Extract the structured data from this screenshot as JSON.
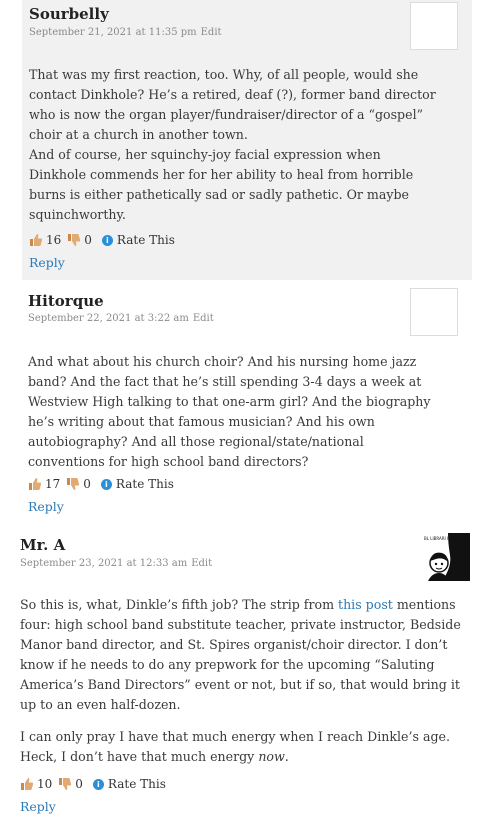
{
  "comments": [
    {
      "author": "Sourbelly",
      "date": "September 21, 2021 at 11:35 pm",
      "edit_label": "Edit",
      "paragraphs": [
        "That was my first reaction, too. Why, of all people, would she contact Dinkhole? He’s a retired, deaf (?), former band director who is now the organ player/fundraiser/director of a “gospel” choir at a church in another town.",
        "And of course, her squinchy-joy facial expression when Dinkhole commends her for her ability to heal from horrible burns is either pathetically sad or sadly pathetic. Or maybe squinchworthy."
      ],
      "likes": "16",
      "dislikes": "0",
      "rate_label": "Rate This",
      "reply_label": "Reply"
    },
    {
      "author": "Hitorque",
      "date": "September 22, 2021 at 3:22 am",
      "edit_label": "Edit",
      "paragraphs": [
        "And what about his church choir? And his nursing home jazz band? And the fact that he’s still spending 3-4 days a week at Westview High talking to that one-arm girl? And the biography he’s writing about that famous musician? And his own autobiography? And all those regional/state/national conventions for high school band directors?"
      ],
      "likes": "17",
      "dislikes": "0",
      "rate_label": "Rate This",
      "reply_label": "Reply"
    },
    {
      "author": "Mr. A",
      "date": "September 23, 2021 at 12:33 am",
      "edit_label": "Edit",
      "p1_before": "So this is, what, Dinkle’s fifth job? The strip from ",
      "p1_link": "this post",
      "p1_after": " mentions four: high school band substitute teacher, private instructor, Bedside Manor band director, and St. Spires organist/choir director. I don’t know if he needs to do any prepwork for the upcoming “Saluting America’s Band Directors” event or not, but if so, that would bring it up to an even half-dozen.",
      "p2_before": "I can only pray I have that much energy when I reach Dinkle’s age. Heck, I don’t have that much energy ",
      "p2_em": "now",
      "p2_after": ".",
      "likes": "10",
      "dislikes": "0",
      "rate_label": "Rate This",
      "reply_label": "Reply",
      "avatar_caption": "BL LIBRARI I DEAL"
    }
  ],
  "colors": {
    "link": "#2a7ab8",
    "thumb": "#d9a36a",
    "info": "#2a8fd6"
  },
  "icons": [
    "thumbs-up-icon",
    "thumbs-down-icon",
    "info-icon"
  ]
}
